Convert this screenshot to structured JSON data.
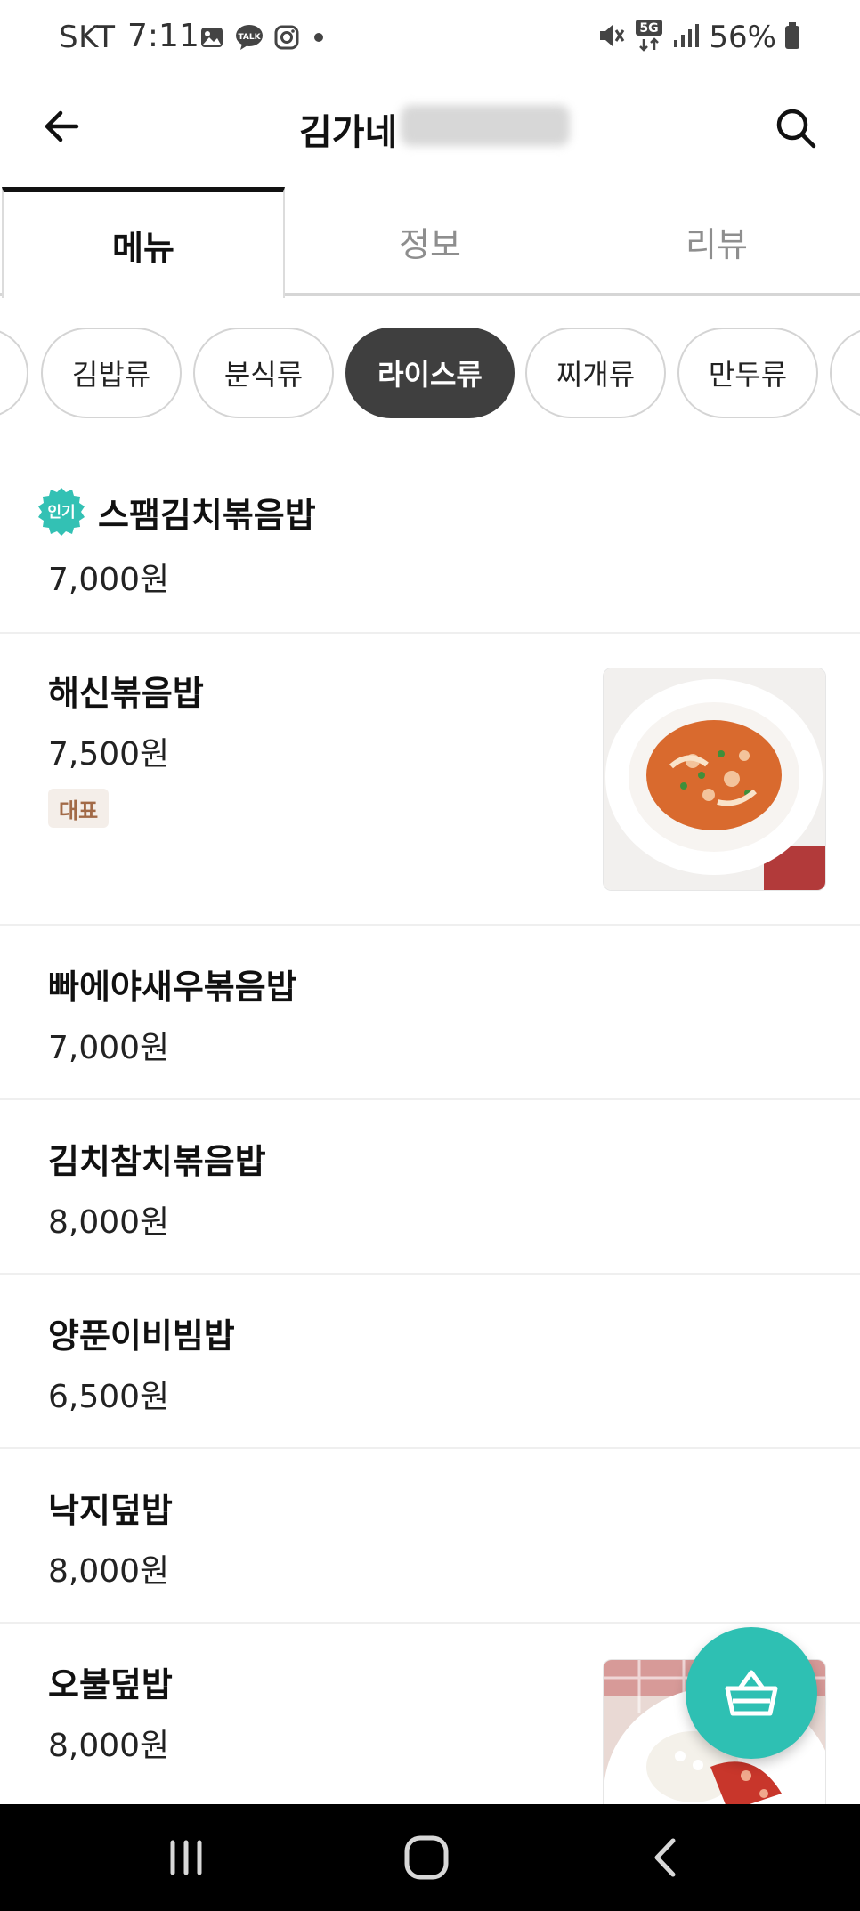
{
  "status_bar": {
    "carrier": "SKT",
    "time": "7:11",
    "battery": "56%",
    "network": "5G",
    "notification_icons": [
      "gallery-icon",
      "talk-icon",
      "instagram-icon",
      "dot-icon"
    ]
  },
  "header": {
    "title": "김가네",
    "back_icon": "back-arrow-icon",
    "search_icon": "search-icon"
  },
  "tabs": [
    {
      "label": "메뉴",
      "active": true
    },
    {
      "label": "정보",
      "active": false
    },
    {
      "label": "리뷰",
      "active": false
    }
  ],
  "categories": [
    {
      "label": "김밥류",
      "active": false
    },
    {
      "label": "분식류",
      "active": false
    },
    {
      "label": "라이스류",
      "active": true
    },
    {
      "label": "찌개류",
      "active": false
    },
    {
      "label": "만두류",
      "active": false
    }
  ],
  "menu": [
    {
      "name": "스팸김치볶음밥",
      "price": "7,000원",
      "badge_popular": "인기"
    },
    {
      "name": "해신볶음밥",
      "price": "7,500원",
      "badge_rep": "대표",
      "has_image": true
    },
    {
      "name": "빠에야새우볶음밥",
      "price": "7,000원"
    },
    {
      "name": "김치참치볶음밥",
      "price": "8,000원"
    },
    {
      "name": "양푼이비빔밥",
      "price": "6,500원"
    },
    {
      "name": "낙지덮밥",
      "price": "8,000원"
    },
    {
      "name": "오불덮밥",
      "price": "8,000원",
      "has_image": true
    }
  ],
  "colors": {
    "accent_teal": "#2ec0b3",
    "active_chip": "#3f3f3f",
    "rep_badge_text": "#a26a47",
    "rep_badge_bg": "#f4eee9"
  },
  "nav_bar": {
    "icons": [
      "recent-apps-icon",
      "home-icon",
      "back-nav-icon"
    ]
  }
}
